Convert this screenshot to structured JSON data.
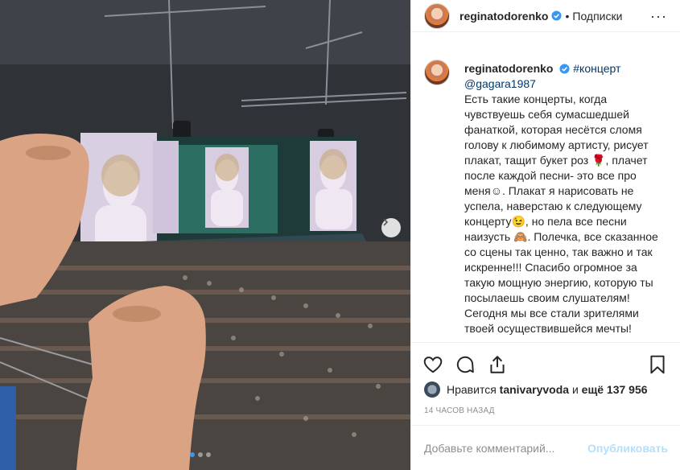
{
  "header": {
    "username": "reginatodorenko",
    "separator": "•",
    "follow_label": "Подписки",
    "more_icon": "more-icon"
  },
  "caption": {
    "username": "reginatodorenko",
    "hashtag": "#концерт",
    "mention": "@gagara1987",
    "text": "Есть такие концерты, когда чувствуешь себя сумасшедшей фанаткой, которая несётся сломя голову к любимому артисту, рисует плакат, тащит букет роз 🌹, плачет после каждой песни- это все про меня☺. Плакат я нарисовать не успела, наверстаю к следующему концерту😉, но пела все песни наизусть 🙈. Полечка, все сказанное со сцены так ценно, так важно и так искренне!!! Спасибо огромное за такую мощную энергию, которую ты посылаешь своим слушателям! Сегодня мы все стали зрителями твоей осуществившейся мечты! Вдохновляй нас дальше на новые"
  },
  "likes": {
    "prefix": "Нравится",
    "user": "tanivaryvoda",
    "conjunction": "и",
    "more_count": "ещё 137 956"
  },
  "timestamp": "14 ЧАСОВ НАЗАД",
  "comment": {
    "placeholder": "Добавьте комментарий...",
    "publish_label": "Опубликовать"
  },
  "colors": {
    "link": "#00376b",
    "verified": "#3897f0",
    "publish_disabled": "#b2dffc",
    "muted": "#8e8e8e",
    "border": "#efefef"
  },
  "carousel": {
    "slides": 3,
    "active": 1
  }
}
